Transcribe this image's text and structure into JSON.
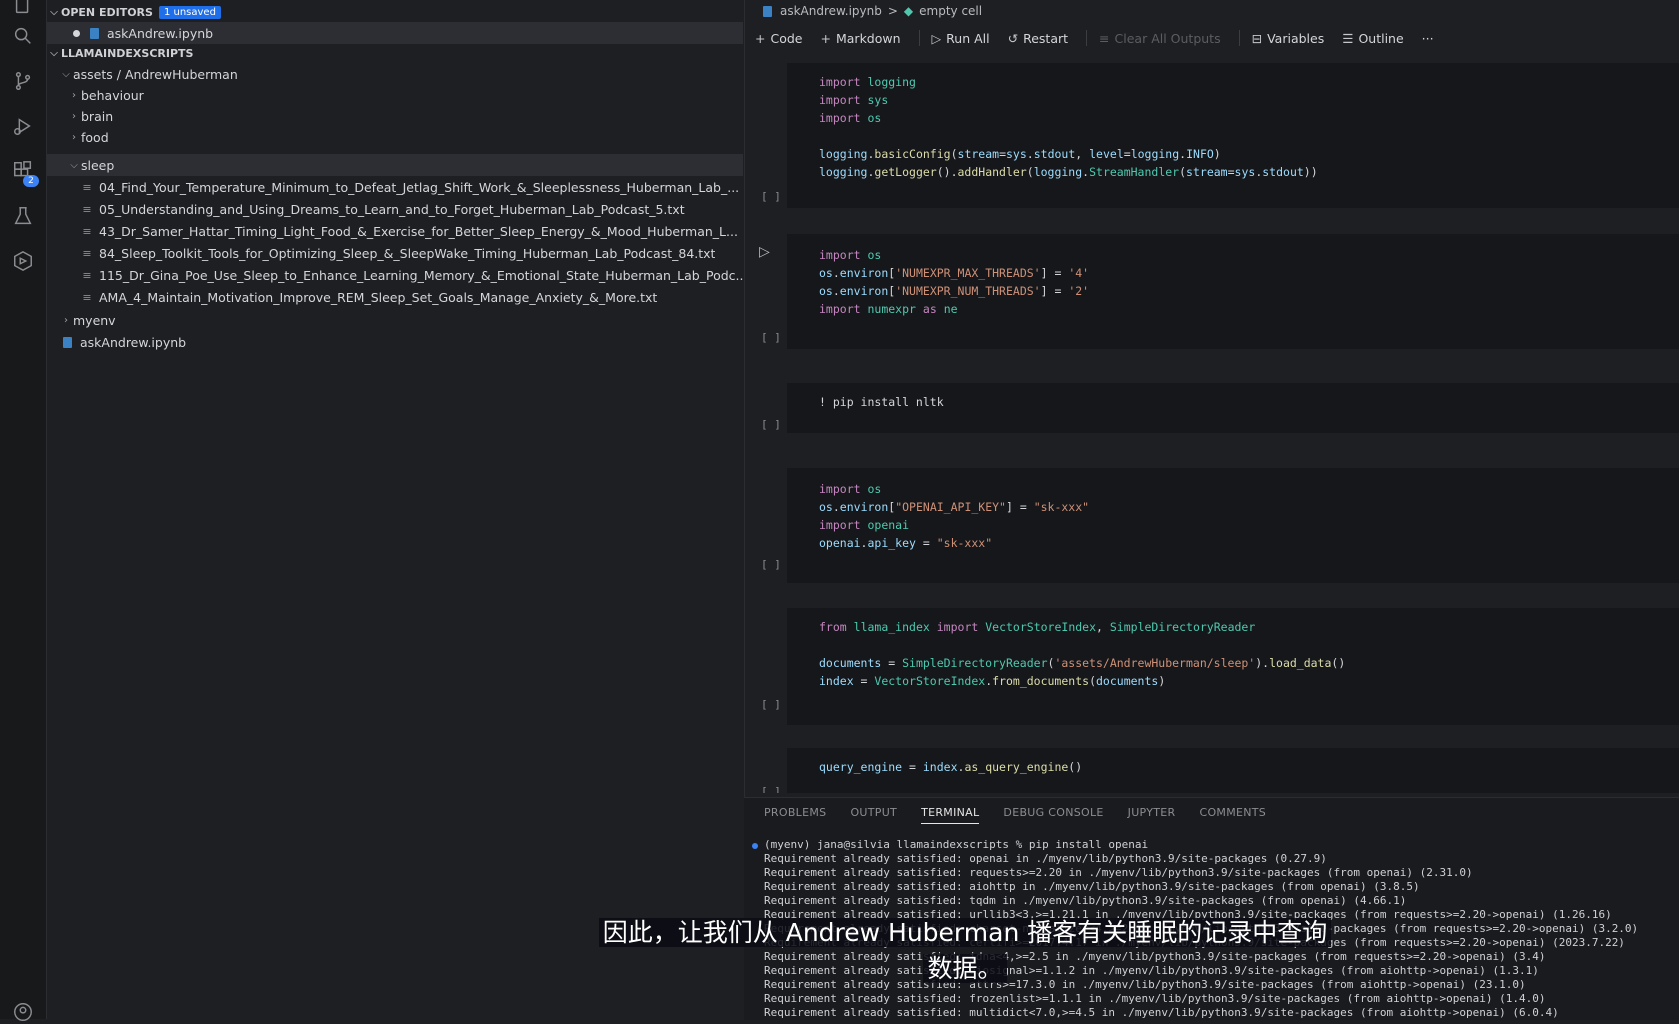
{
  "explorer": {
    "open_editors_label": "OPEN EDITORS",
    "unsaved_badge": "1 unsaved",
    "open_file": "askAndrew.ipynb",
    "project_label": "LLAMAINDEXSCRIPTS",
    "assets_folder": "assets / AndrewHuberman",
    "folders": [
      "behaviour",
      "brain",
      "food",
      "sleep"
    ],
    "sleep_files": [
      "04_Find_Your_Temperature_Minimum_to_Defeat_Jetlag_Shift_Work_&_Sleeplessness_Huberman_Lab_...",
      "05_Understanding_and_Using_Dreams_to_Learn_and_to_Forget_Huberman_Lab_Podcast_5.txt",
      "43_Dr_Samer_Hattar_Timing_Light_Food_&_Exercise_for_Better_Sleep_Energy_&_Mood_Huberman_L...",
      "84_Sleep_Toolkit_Tools_for_Optimizing_Sleep_&_SleepWake_Timing_Huberman_Lab_Podcast_84.txt",
      "115_Dr_Gina_Poe_Use_Sleep_to_Enhance_Learning_Memory_&_Emotional_State_Huberman_Lab_Podc...",
      "AMA_4_Maintain_Motivation_Improve_REM_Sleep_Set_Goals_Manage_Anxiety_&_More.txt"
    ],
    "myenv": "myenv",
    "root_file": "askAndrew.ipynb"
  },
  "activity": {
    "extensions_badge": "2"
  },
  "editor": {
    "breadcrumb_file": "askAndrew.ipynb",
    "breadcrumb_sep": ">",
    "breadcrumb_cell": "empty cell",
    "toolbar": {
      "code": "Code",
      "markdown": "Markdown",
      "run_all": "Run All",
      "restart": "Restart",
      "clear_outputs": "Clear All Outputs",
      "variables": "Variables",
      "outline": "Outline",
      "more": "···"
    },
    "cell_bracket": "[ ]"
  },
  "panel": {
    "tabs": [
      "PROBLEMS",
      "OUTPUT",
      "TERMINAL",
      "DEBUG CONSOLE",
      "JUPYTER",
      "COMMENTS"
    ],
    "terminal_lines": [
      "(myenv) jana@silvia llamaindexscripts % pip install openai",
      "Requirement already satisfied: openai in ./myenv/lib/python3.9/site-packages (0.27.9)",
      "Requirement already satisfied: requests>=2.20 in ./myenv/lib/python3.9/site-packages (from openai) (2.31.0)",
      "Requirement already satisfied: aiohttp in ./myenv/lib/python3.9/site-packages (from openai) (3.8.5)",
      "Requirement already satisfied: tqdm in ./myenv/lib/python3.9/site-packages (from openai) (4.66.1)",
      "Requirement already satisfied: urllib3<3,>=1.21.1 in ./myenv/lib/python3.9/site-packages (from requests>=2.20->openai) (1.26.16)",
      "Requirement already satisfied: charset-normalizer<4,>=2 in ./myenv/lib/python3.9/site-packages (from requests>=2.20->openai) (3.2.0)",
      "Requirement already satisfied: certifi>=2017.4.17 in ./myenv/lib/python3.9/site-packages (from requests>=2.20->openai) (2023.7.22)",
      "Requirement already satisfied: idna<4,>=2.5 in ./myenv/lib/python3.9/site-packages (from requests>=2.20->openai) (3.4)",
      "Requirement already satisfied: aiosignal>=1.1.2 in ./myenv/lib/python3.9/site-packages (from aiohttp->openai) (1.3.1)",
      "Requirement already satisfied: attrs>=17.3.0 in ./myenv/lib/python3.9/site-packages (from aiohttp->openai) (23.1.0)",
      "Requirement already satisfied: frozenlist>=1.1.1 in ./myenv/lib/python3.9/site-packages (from aiohttp->openai) (1.4.0)",
      "Requirement already satisfied: multidict<7.0,>=4.5 in ./myenv/lib/python3.9/site-packages (from aiohttp->openai) (6.0.4)"
    ]
  },
  "subtitle": {
    "line1": "因此，让我们从 Andrew Huberman 播客有关睡眠的记录中查询",
    "line2": "数据。"
  }
}
